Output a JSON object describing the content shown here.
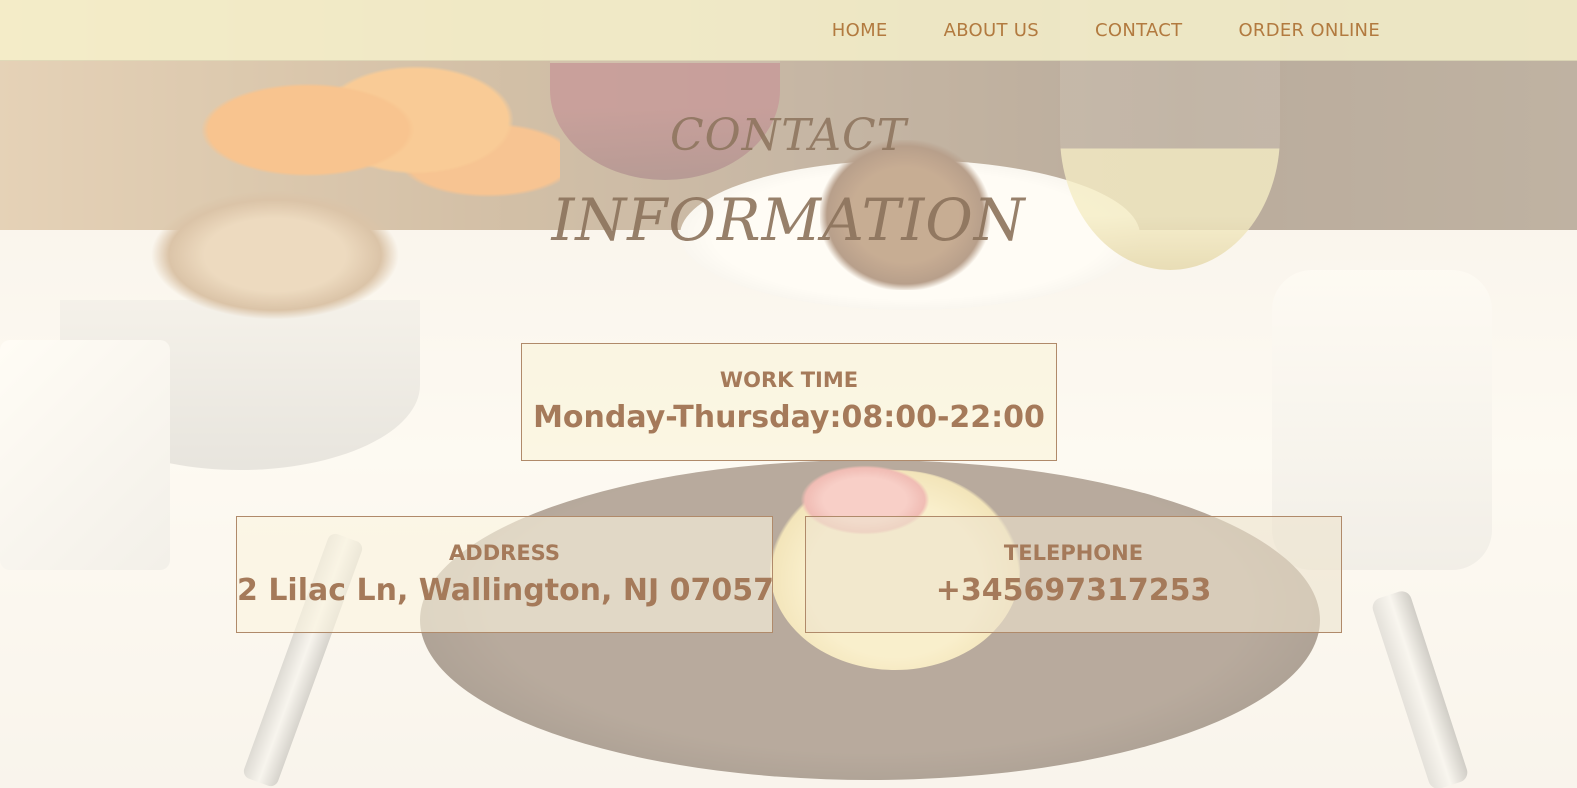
{
  "nav": {
    "items": [
      {
        "label": "HOME"
      },
      {
        "label": "ABOUT US"
      },
      {
        "label": "CONTACT"
      },
      {
        "label": "ORDER ONLINE"
      }
    ]
  },
  "hero": {
    "title_line1": "CONTACT",
    "title_line2": "INFORMATION"
  },
  "work_time": {
    "label": "WORK TIME",
    "value": "Monday-Thursday:08:00-22:00"
  },
  "address": {
    "label": "ADDRESS",
    "value": "2 Lilac Ln, Wallington, NJ 07057"
  },
  "telephone": {
    "label": "TELEPHONE",
    "value": "+345697317253"
  },
  "colors": {
    "accent": "#b27a3f",
    "box_text": "#a57a5a",
    "header_bg": "#f6f2cc"
  }
}
